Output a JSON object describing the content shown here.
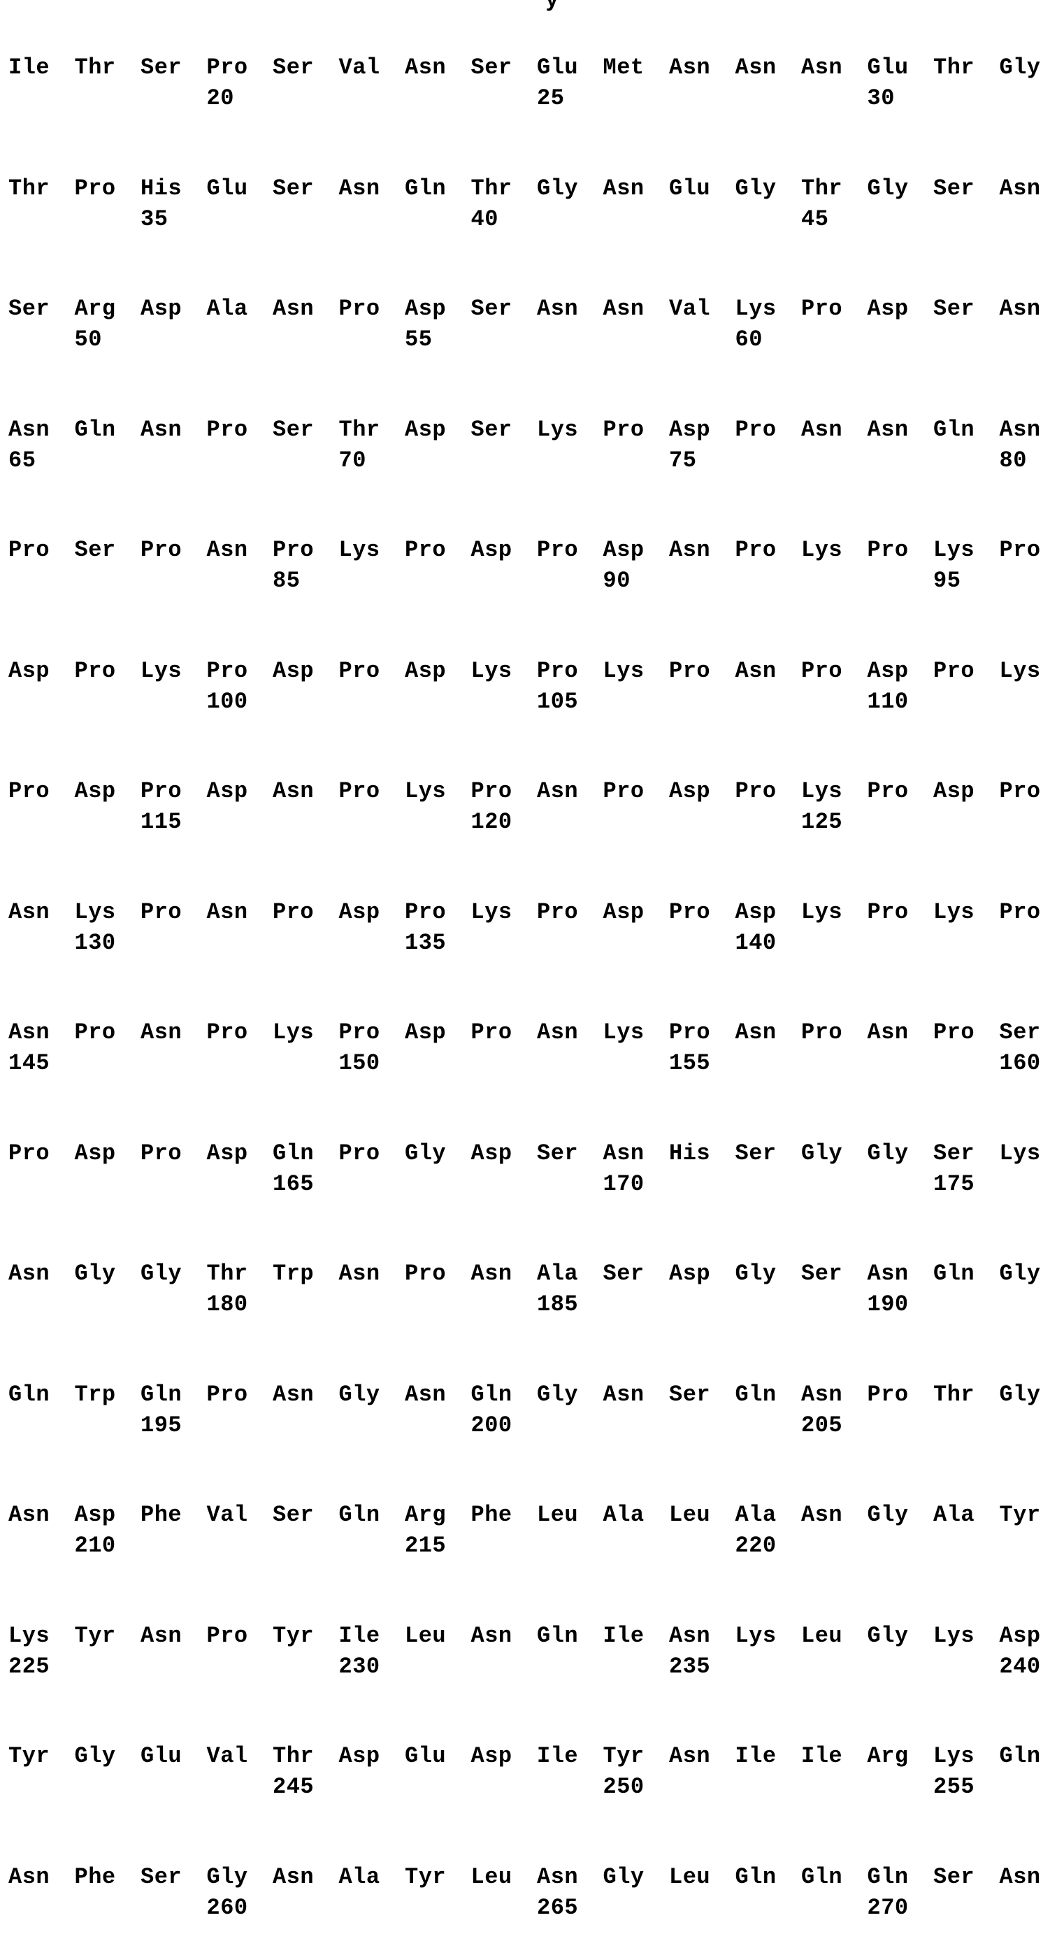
{
  "header_fragment": "y",
  "rows": [
    {
      "residues": [
        "Ile",
        "Thr",
        "Ser",
        "Pro",
        "Ser",
        "Val",
        "Asn",
        "Ser",
        "Glu",
        "Met",
        "Asn",
        "Asn",
        "Asn",
        "Glu",
        "Thr",
        "Gly"
      ],
      "numbers": [
        {
          "col": 3,
          "text": "20"
        },
        {
          "col": 8,
          "text": "25"
        },
        {
          "col": 13,
          "text": "30"
        }
      ]
    },
    {
      "residues": [
        "Thr",
        "Pro",
        "His",
        "Glu",
        "Ser",
        "Asn",
        "Gln",
        "Thr",
        "Gly",
        "Asn",
        "Glu",
        "Gly",
        "Thr",
        "Gly",
        "Ser",
        "Asn"
      ],
      "numbers": [
        {
          "col": 2,
          "text": "35"
        },
        {
          "col": 7,
          "text": "40"
        },
        {
          "col": 12,
          "text": "45"
        }
      ]
    },
    {
      "residues": [
        "Ser",
        "Arg",
        "Asp",
        "Ala",
        "Asn",
        "Pro",
        "Asp",
        "Ser",
        "Asn",
        "Asn",
        "Val",
        "Lys",
        "Pro",
        "Asp",
        "Ser",
        "Asn"
      ],
      "numbers": [
        {
          "col": 1,
          "text": "50"
        },
        {
          "col": 6,
          "text": "55"
        },
        {
          "col": 11,
          "text": "60"
        }
      ]
    },
    {
      "residues": [
        "Asn",
        "Gln",
        "Asn",
        "Pro",
        "Ser",
        "Thr",
        "Asp",
        "Ser",
        "Lys",
        "Pro",
        "Asp",
        "Pro",
        "Asn",
        "Asn",
        "Gln",
        "Asn"
      ],
      "numbers": [
        {
          "col": 0,
          "text": "65"
        },
        {
          "col": 5,
          "text": "70"
        },
        {
          "col": 10,
          "text": "75"
        },
        {
          "col": 15,
          "text": "80"
        }
      ]
    },
    {
      "residues": [
        "Pro",
        "Ser",
        "Pro",
        "Asn",
        "Pro",
        "Lys",
        "Pro",
        "Asp",
        "Pro",
        "Asp",
        "Asn",
        "Pro",
        "Lys",
        "Pro",
        "Lys",
        "Pro"
      ],
      "numbers": [
        {
          "col": 4,
          "text": "85"
        },
        {
          "col": 9,
          "text": "90"
        },
        {
          "col": 14,
          "text": "95"
        }
      ]
    },
    {
      "residues": [
        "Asp",
        "Pro",
        "Lys",
        "Pro",
        "Asp",
        "Pro",
        "Asp",
        "Lys",
        "Pro",
        "Lys",
        "Pro",
        "Asn",
        "Pro",
        "Asp",
        "Pro",
        "Lys"
      ],
      "numbers": [
        {
          "col": 3,
          "text": "100"
        },
        {
          "col": 8,
          "text": "105"
        },
        {
          "col": 13,
          "text": "110"
        }
      ]
    },
    {
      "residues": [
        "Pro",
        "Asp",
        "Pro",
        "Asp",
        "Asn",
        "Pro",
        "Lys",
        "Pro",
        "Asn",
        "Pro",
        "Asp",
        "Pro",
        "Lys",
        "Pro",
        "Asp",
        "Pro"
      ],
      "numbers": [
        {
          "col": 2,
          "text": "115"
        },
        {
          "col": 7,
          "text": "120"
        },
        {
          "col": 12,
          "text": "125"
        }
      ]
    },
    {
      "residues": [
        "Asn",
        "Lys",
        "Pro",
        "Asn",
        "Pro",
        "Asp",
        "Pro",
        "Lys",
        "Pro",
        "Asp",
        "Pro",
        "Asp",
        "Lys",
        "Pro",
        "Lys",
        "Pro"
      ],
      "numbers": [
        {
          "col": 1,
          "text": "130"
        },
        {
          "col": 6,
          "text": "135"
        },
        {
          "col": 11,
          "text": "140"
        }
      ]
    },
    {
      "residues": [
        "Asn",
        "Pro",
        "Asn",
        "Pro",
        "Lys",
        "Pro",
        "Asp",
        "Pro",
        "Asn",
        "Lys",
        "Pro",
        "Asn",
        "Pro",
        "Asn",
        "Pro",
        "Ser"
      ],
      "numbers": [
        {
          "col": 0,
          "text": "145"
        },
        {
          "col": 5,
          "text": "150"
        },
        {
          "col": 10,
          "text": "155"
        },
        {
          "col": 15,
          "text": "160"
        }
      ]
    },
    {
      "residues": [
        "Pro",
        "Asp",
        "Pro",
        "Asp",
        "Gln",
        "Pro",
        "Gly",
        "Asp",
        "Ser",
        "Asn",
        "His",
        "Ser",
        "Gly",
        "Gly",
        "Ser",
        "Lys"
      ],
      "numbers": [
        {
          "col": 4,
          "text": "165"
        },
        {
          "col": 9,
          "text": "170"
        },
        {
          "col": 14,
          "text": "175"
        }
      ]
    },
    {
      "residues": [
        "Asn",
        "Gly",
        "Gly",
        "Thr",
        "Trp",
        "Asn",
        "Pro",
        "Asn",
        "Ala",
        "Ser",
        "Asp",
        "Gly",
        "Ser",
        "Asn",
        "Gln",
        "Gly"
      ],
      "numbers": [
        {
          "col": 3,
          "text": "180"
        },
        {
          "col": 8,
          "text": "185"
        },
        {
          "col": 13,
          "text": "190"
        }
      ]
    },
    {
      "residues": [
        "Gln",
        "Trp",
        "Gln",
        "Pro",
        "Asn",
        "Gly",
        "Asn",
        "Gln",
        "Gly",
        "Asn",
        "Ser",
        "Gln",
        "Asn",
        "Pro",
        "Thr",
        "Gly"
      ],
      "numbers": [
        {
          "col": 2,
          "text": "195"
        },
        {
          "col": 7,
          "text": "200"
        },
        {
          "col": 12,
          "text": "205"
        }
      ]
    },
    {
      "residues": [
        "Asn",
        "Asp",
        "Phe",
        "Val",
        "Ser",
        "Gln",
        "Arg",
        "Phe",
        "Leu",
        "Ala",
        "Leu",
        "Ala",
        "Asn",
        "Gly",
        "Ala",
        "Tyr"
      ],
      "numbers": [
        {
          "col": 1,
          "text": "210"
        },
        {
          "col": 6,
          "text": "215"
        },
        {
          "col": 11,
          "text": "220"
        }
      ]
    },
    {
      "residues": [
        "Lys",
        "Tyr",
        "Asn",
        "Pro",
        "Tyr",
        "Ile",
        "Leu",
        "Asn",
        "Gln",
        "Ile",
        "Asn",
        "Lys",
        "Leu",
        "Gly",
        "Lys",
        "Asp"
      ],
      "numbers": [
        {
          "col": 0,
          "text": "225"
        },
        {
          "col": 5,
          "text": "230"
        },
        {
          "col": 10,
          "text": "235"
        },
        {
          "col": 15,
          "text": "240"
        }
      ]
    },
    {
      "residues": [
        "Tyr",
        "Gly",
        "Glu",
        "Val",
        "Thr",
        "Asp",
        "Glu",
        "Asp",
        "Ile",
        "Tyr",
        "Asn",
        "Ile",
        "Ile",
        "Arg",
        "Lys",
        "Gln"
      ],
      "numbers": [
        {
          "col": 4,
          "text": "245"
        },
        {
          "col": 9,
          "text": "250"
        },
        {
          "col": 14,
          "text": "255"
        }
      ]
    },
    {
      "residues": [
        "Asn",
        "Phe",
        "Ser",
        "Gly",
        "Asn",
        "Ala",
        "Tyr",
        "Leu",
        "Asn",
        "Gly",
        "Leu",
        "Gln",
        "Gln",
        "Gln",
        "Ser",
        "Asn"
      ],
      "numbers": [
        {
          "col": 3,
          "text": "260"
        },
        {
          "col": 8,
          "text": "265"
        },
        {
          "col": 13,
          "text": "270"
        }
      ]
    }
  ]
}
